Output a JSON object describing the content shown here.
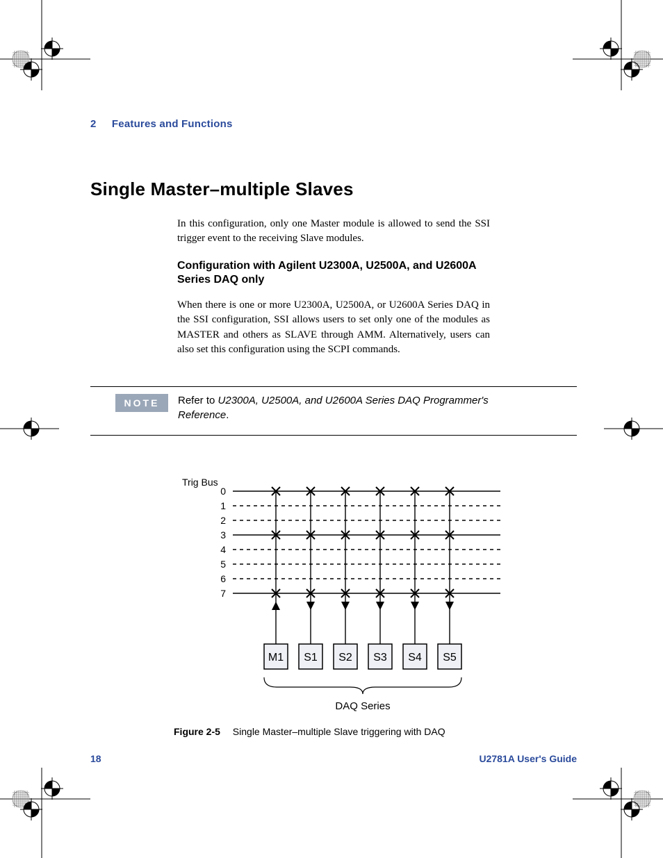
{
  "header": {
    "chapter_num": "2",
    "chapter_title": "Features and Functions"
  },
  "section": {
    "title": "Single Master–multiple Slaves",
    "intro": "In this configuration, only one Master module is allowed to send the SSI trigger event to the receiving Slave modules.",
    "sub_title": "Configuration with Agilent U2300A, U2500A, and U2600A Series DAQ only",
    "sub_body": "When there is one or more U2300A, U2500A, or U2600A Series DAQ in the SSI configuration, SSI allows users to set only one of the modules as MASTER and others as SLAVE through AMM. Alternatively, users can also set this configuration using the SCPI commands."
  },
  "note": {
    "label": "NOTE",
    "text_prefix": "Refer to ",
    "text_italic": "U2300A, U2500A, and U2600A Series DAQ Programmer's Reference",
    "text_suffix": "."
  },
  "diagram": {
    "trig_bus_label": "Trig Bus",
    "lines": [
      "0",
      "1",
      "2",
      "3",
      "4",
      "5",
      "6",
      "7"
    ],
    "solid_lines": [
      "0",
      "3",
      "7"
    ],
    "nodes": [
      "M1",
      "S1",
      "S2",
      "S3",
      "S4",
      "S5"
    ],
    "brace_label": "DAQ Series"
  },
  "figure": {
    "id": "Figure 2-5",
    "caption": "Single Master–multiple Slave triggering with DAQ"
  },
  "footer": {
    "page_num": "18",
    "guide": "U2781A User's Guide"
  }
}
